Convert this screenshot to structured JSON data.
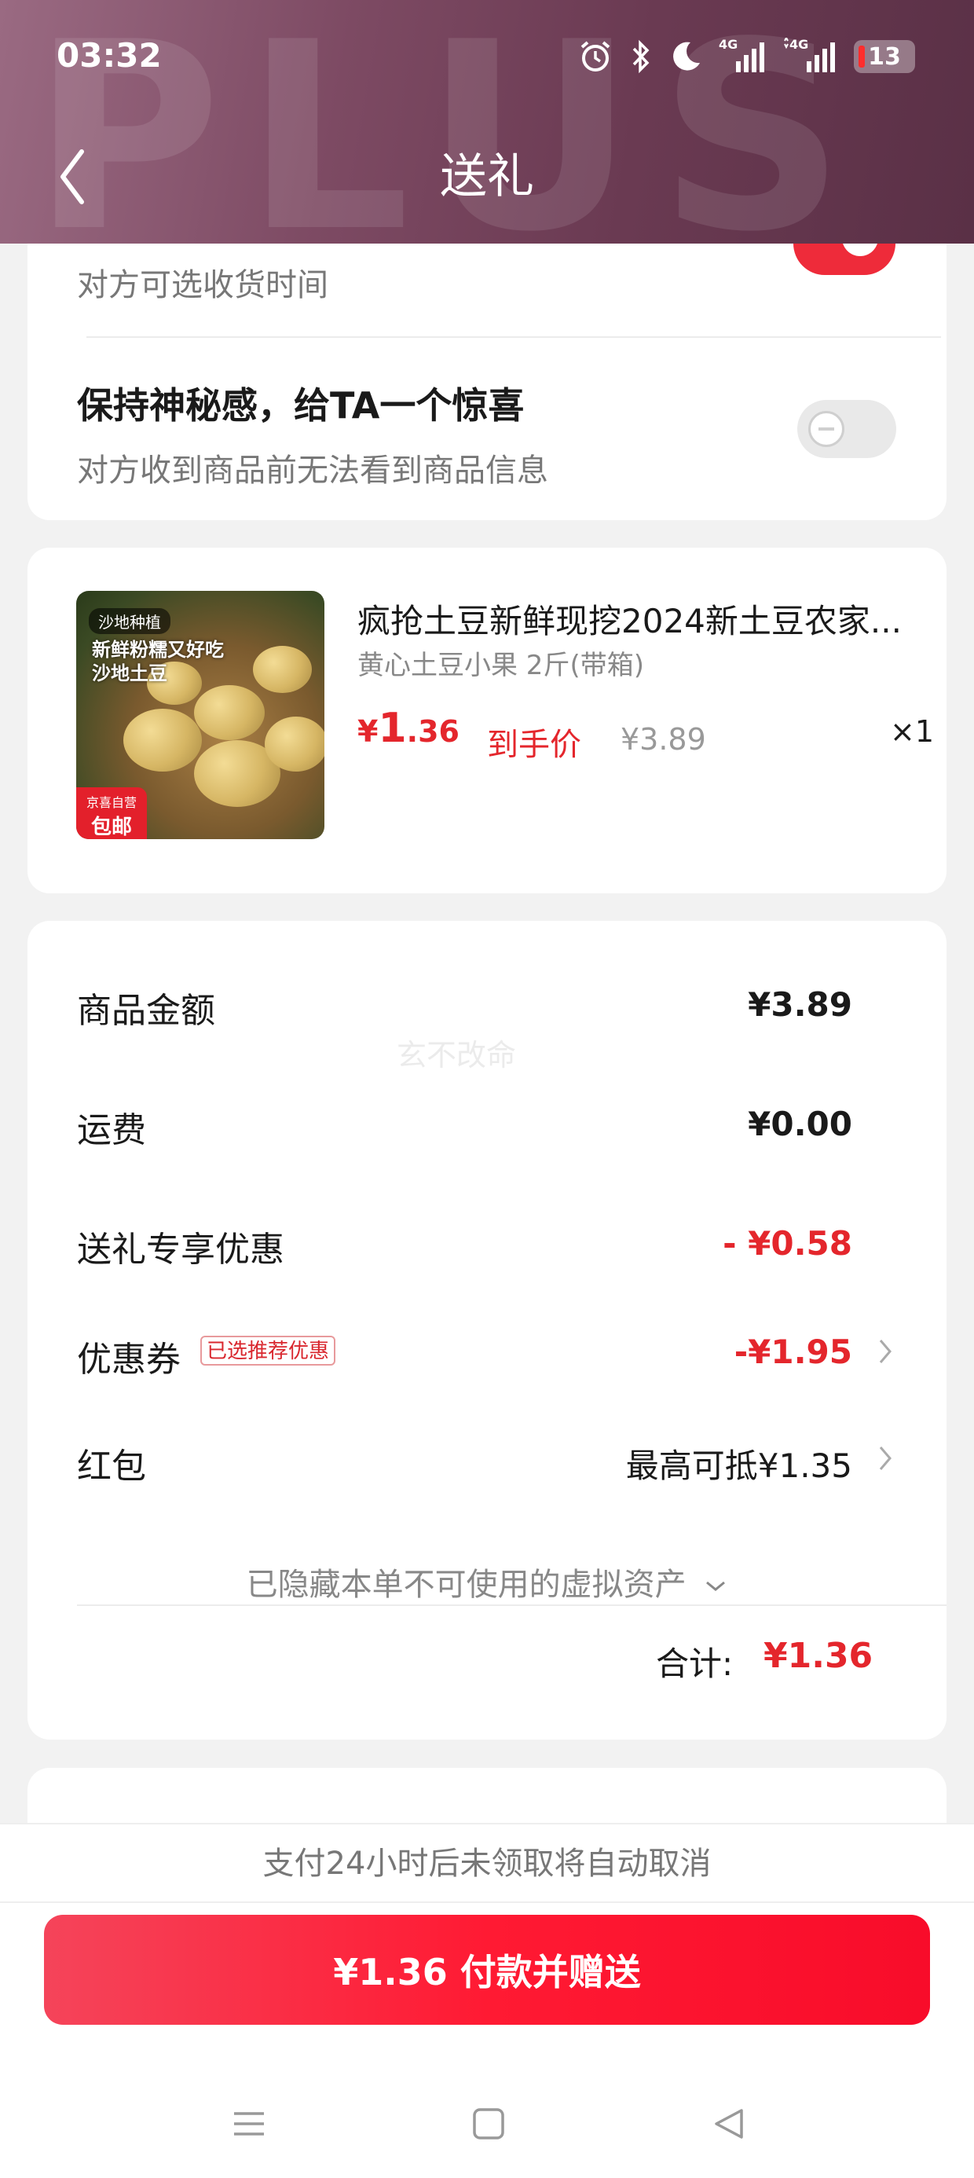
{
  "status_bar": {
    "time": "03:32",
    "battery_level": "13",
    "network_1": "4G",
    "network_2": "4G"
  },
  "header": {
    "title": "送礼",
    "watermark": "PLUS"
  },
  "options": {
    "delivery_time_sub": "对方可选收货时间",
    "delivery_time_toggle_on": true,
    "surprise_title": "保持神秘感，给TA一个惊喜",
    "surprise_sub": "对方收到商品前无法看到商品信息",
    "surprise_toggle_on": false
  },
  "product": {
    "title": "疯抢土豆新鲜现挖2024新土豆农家...",
    "spec": "黄心土豆小果 2斤(带箱)",
    "price_currency": "¥",
    "price_int": "1",
    "price_dec": ".36",
    "price_label": "到手价",
    "original_price": "¥3.89",
    "quantity": "×1",
    "image_tag": "沙地种植",
    "image_text": "新鲜粉糯又好吃 沙地土豆",
    "image_badge_top": "京喜自营",
    "image_badge_bottom": "包邮"
  },
  "fees": {
    "goods_amount_label": "商品金额",
    "goods_amount_value": "¥3.89",
    "shipping_label": "运费",
    "shipping_value": "¥0.00",
    "gift_discount_label": "送礼专享优惠",
    "gift_discount_value": "- ¥0.58",
    "coupon_label": "优惠券",
    "coupon_tag": "已选推荐优惠",
    "coupon_value": "-¥1.95",
    "redpacket_label": "红包",
    "redpacket_value": "最高可抵¥1.35",
    "hidden_assets": "已隐藏本单不可使用的虚拟资产",
    "total_label": "合计:",
    "total_value": "¥1.36",
    "watermark": "玄不改命"
  },
  "footer": {
    "notice": "支付24小时后未领取将自动取消",
    "pay_button": "¥1.36 付款并赠送"
  },
  "colors": {
    "accent_red": "#e4262c",
    "header_bg": "#7d4a63",
    "pay_button": "#ff1a33"
  }
}
